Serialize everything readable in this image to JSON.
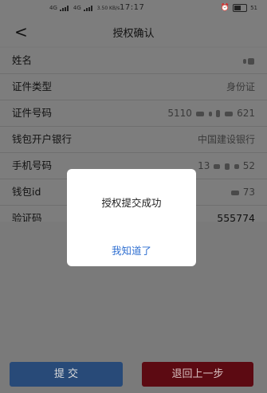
{
  "status_bar": {
    "network_a": "4G",
    "network_b": "4G",
    "speed": "3.50 KB/s",
    "time": "17:17",
    "battery": "51"
  },
  "nav": {
    "back_icon": "chevron-left-icon",
    "title": "授权确认"
  },
  "form": {
    "rows": [
      {
        "label": "姓名",
        "value": ""
      },
      {
        "label": "证件类型",
        "value": "身份证"
      },
      {
        "label": "证件号码",
        "value_prefix": "5110",
        "value_suffix": "621"
      },
      {
        "label": "钱包开户银行",
        "value": "中国建设银行"
      },
      {
        "label": "手机号码",
        "value_prefix": "13",
        "value_suffix": "52"
      },
      {
        "label": "钱包id",
        "value_suffix": "73"
      },
      {
        "label": "验证码",
        "value": "555774"
      }
    ]
  },
  "dialog": {
    "message": "授权提交成功",
    "confirm_label": "我知道了"
  },
  "buttons": {
    "submit_label": "提 交",
    "back_label": "退回上一步"
  },
  "colors": {
    "submit": "#3d7fd9",
    "back": "#b3111e",
    "link": "#2f6fd1"
  }
}
